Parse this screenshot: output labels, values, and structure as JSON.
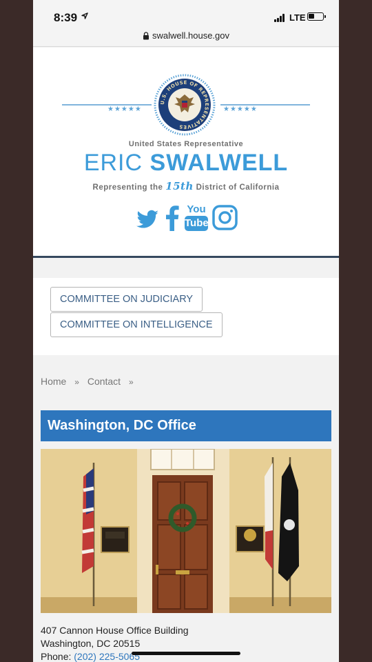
{
  "status": {
    "time": "8:39",
    "network": "LTE",
    "url": "swalwell.house.gov"
  },
  "header": {
    "seal_text": "U.S. HOUSE OF REPRESENTATIVES",
    "stars": "★★★★★",
    "rep_line": "United States Representative",
    "first_name": "ERIC",
    "last_name": "SWALWELL",
    "district_prefix": "Representing the",
    "district_number": "15th",
    "district_suffix": "District of California",
    "social": [
      "twitter-icon",
      "facebook-icon",
      "youtube-icon",
      "instagram-icon"
    ],
    "youtube_top": "You",
    "youtube_bottom": "Tube"
  },
  "committees": [
    {
      "label": "COMMITTEE ON JUDICIARY"
    },
    {
      "label": "COMMITTEE ON INTELLIGENCE"
    }
  ],
  "breadcrumb": {
    "home": "Home",
    "separator": "»",
    "contact": "Contact"
  },
  "office": {
    "title": "Washington, DC Office",
    "address_line1": "407 Cannon House Office Building",
    "address_line2": "Washington, DC 20515",
    "phone_label": "Phone:",
    "phone_number": "(202) 225-5065"
  },
  "colors": {
    "brand_blue": "#3c9bd9",
    "title_bar": "#2e76bd",
    "link": "#3b5f86"
  }
}
